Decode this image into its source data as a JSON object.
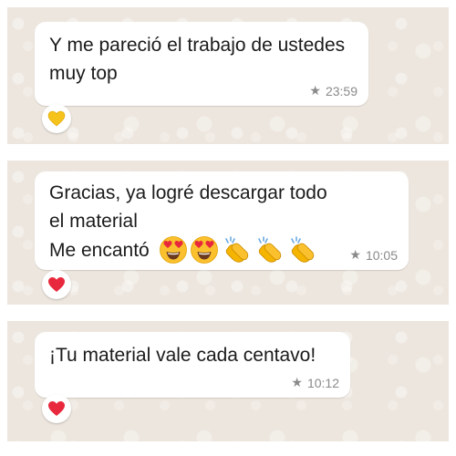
{
  "messages": [
    {
      "lines": [
        "Y me pareció el trabajo de ustedes",
        "muy top"
      ],
      "time": "23:59",
      "starred": true,
      "reaction": "yellow-heart"
    },
    {
      "lines": [
        "Gracias, ya logré descargar todo",
        "el material",
        "Me encantó"
      ],
      "emojis": [
        "heart-eyes",
        "heart-eyes",
        "clapping-hands",
        "clapping-hands",
        "clapping-hands"
      ],
      "time": "10:05",
      "starred": true,
      "reaction": "red-heart"
    },
    {
      "lines": [
        "¡Tu material vale cada centavo!"
      ],
      "time": "10:12",
      "starred": true,
      "reaction": "red-heart"
    }
  ],
  "colors": {
    "chat_background": "#ede6de",
    "bubble": "#ffffff",
    "meta_text": "#8a8a8a",
    "red_heart": "#e8283c",
    "yellow_heart": "#f6c31c",
    "emoji_face": "#fbc02d"
  }
}
